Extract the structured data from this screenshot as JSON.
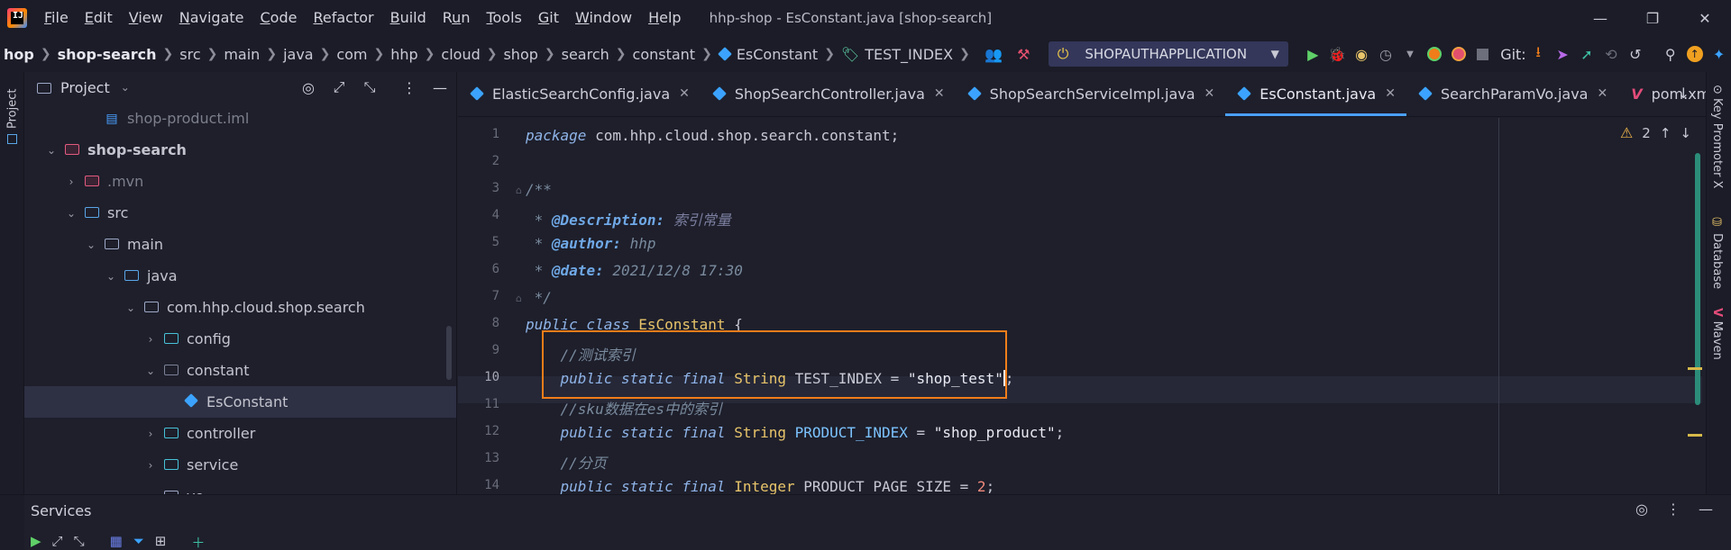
{
  "window": {
    "title": "hhp-shop - EsConstant.java [shop-search]",
    "minimize": "—",
    "maximize": "❐",
    "close": "✕"
  },
  "menu": [
    {
      "pre": "",
      "u": "F",
      "post": "ile"
    },
    {
      "pre": "",
      "u": "E",
      "post": "dit"
    },
    {
      "pre": "",
      "u": "V",
      "post": "iew"
    },
    {
      "pre": "",
      "u": "N",
      "post": "avigate"
    },
    {
      "pre": "",
      "u": "C",
      "post": "ode"
    },
    {
      "pre": "",
      "u": "R",
      "post": "efactor"
    },
    {
      "pre": "",
      "u": "B",
      "post": "uild"
    },
    {
      "pre": "R",
      "u": "u",
      "post": "n"
    },
    {
      "pre": "",
      "u": "T",
      "post": "ools"
    },
    {
      "pre": "",
      "u": "G",
      "post": "it"
    },
    {
      "pre": "",
      "u": "W",
      "post": "indow"
    },
    {
      "pre": "",
      "u": "H",
      "post": "elp"
    }
  ],
  "breadcrumb": [
    "hop",
    "shop-search",
    "src",
    "main",
    "java",
    "com",
    "hhp",
    "cloud",
    "shop",
    "search",
    "constant",
    "EsConstant",
    "TEST_INDEX"
  ],
  "run_config": "SHOPAUTHAPPLICATION",
  "git_label": "Git:",
  "project": {
    "title": "Project",
    "tree": [
      {
        "label": "shop-product.iml",
        "indent": 3,
        "chev": "",
        "icon": "iml",
        "dim": true
      },
      {
        "label": "shop-search",
        "indent": 1,
        "chev": "v",
        "icon": "folder-pink",
        "bold": true
      },
      {
        "label": ".mvn",
        "indent": 2,
        "chev": ">",
        "icon": "folder-pink-solid",
        "dim": true
      },
      {
        "label": "src",
        "indent": 2,
        "chev": "v",
        "icon": "folder-src"
      },
      {
        "label": "main",
        "indent": 3,
        "chev": "v",
        "icon": "folder"
      },
      {
        "label": "java",
        "indent": 4,
        "chev": "v",
        "icon": "folder-java"
      },
      {
        "label": "com.hhp.cloud.shop.search",
        "indent": 5,
        "chev": "v",
        "icon": "folder"
      },
      {
        "label": "config",
        "indent": 6,
        "chev": ">",
        "icon": "folder-config"
      },
      {
        "label": "constant",
        "indent": 6,
        "chev": "v",
        "icon": "folder-dim"
      },
      {
        "label": "EsConstant",
        "indent": 7,
        "chev": "",
        "icon": "class",
        "selected": true
      },
      {
        "label": "controller",
        "indent": 6,
        "chev": ">",
        "icon": "folder-config"
      },
      {
        "label": "service",
        "indent": 6,
        "chev": ">",
        "icon": "folder-service"
      },
      {
        "label": "vo",
        "indent": 6,
        "chev": ">",
        "icon": "folder"
      }
    ]
  },
  "tabs": [
    {
      "label": "ElasticSearchConfig.java",
      "icon": "class"
    },
    {
      "label": "ShopSearchController.java",
      "icon": "class"
    },
    {
      "label": "ShopSearchServiceImpl.java",
      "icon": "class"
    },
    {
      "label": "EsConstant.java",
      "icon": "class",
      "active": true
    },
    {
      "label": "SearchParamVo.java",
      "icon": "class"
    },
    {
      "label": "pom.xml (shop-search)",
      "icon": "maven"
    }
  ],
  "inspection": {
    "warnings": "2"
  },
  "code": {
    "current_line": 10,
    "lines": [
      {
        "n": "1",
        "parts": [
          [
            "kw",
            "package "
          ],
          [
            "plain",
            "com.hhp.cloud.shop.search.constant;"
          ]
        ]
      },
      {
        "n": "2",
        "parts": []
      },
      {
        "n": "3",
        "parts": [
          [
            "cm",
            "/**"
          ]
        ]
      },
      {
        "n": "4",
        "parts": [
          [
            "cm",
            " * "
          ],
          [
            "cm-tag",
            "@Description:"
          ],
          [
            "cm-cn",
            " 索引常量"
          ]
        ]
      },
      {
        "n": "5",
        "parts": [
          [
            "cm",
            " * "
          ],
          [
            "cm-tag",
            "@author:"
          ],
          [
            "cm",
            " hhp"
          ]
        ]
      },
      {
        "n": "6",
        "parts": [
          [
            "cm",
            " * "
          ],
          [
            "cm-tag",
            "@date:"
          ],
          [
            "cm",
            " 2021/12/8 17:30"
          ]
        ]
      },
      {
        "n": "7",
        "parts": [
          [
            "cm",
            " */"
          ]
        ]
      },
      {
        "n": "8",
        "parts": [
          [
            "kw",
            "public class "
          ],
          [
            "cl-name",
            "EsConstant"
          ],
          [
            "plain",
            " {"
          ]
        ]
      },
      {
        "n": "9",
        "parts": [
          [
            "cm",
            "    //测试索引"
          ]
        ]
      },
      {
        "n": "10",
        "parts": [
          [
            "kw",
            "    public static final "
          ],
          [
            "ty",
            "String "
          ],
          [
            "const",
            "TEST_INDEX"
          ],
          [
            "plain",
            " = "
          ],
          [
            "str",
            "\"shop_test\""
          ],
          [
            "caret",
            ""
          ],
          [
            "plain",
            ";"
          ]
        ]
      },
      {
        "n": "11",
        "parts": [
          [
            "cm",
            "    //sku数据在es中的索引"
          ]
        ]
      },
      {
        "n": "12",
        "parts": [
          [
            "kw",
            "    public static final "
          ],
          [
            "ty",
            "String "
          ],
          [
            "const-blue",
            "PRODUCT_INDEX"
          ],
          [
            "plain",
            " = "
          ],
          [
            "str",
            "\"shop_product\""
          ],
          [
            "plain",
            ";"
          ]
        ]
      },
      {
        "n": "13",
        "parts": [
          [
            "cm",
            "    //分页"
          ]
        ]
      },
      {
        "n": "14",
        "parts": [
          [
            "kw",
            "    public static final "
          ],
          [
            "ty",
            "Integer "
          ],
          [
            "const",
            "PRODUCT_PAGE_SIZE"
          ],
          [
            "plain",
            " = "
          ],
          [
            "num",
            "2"
          ],
          [
            "plain",
            ";"
          ]
        ]
      }
    ]
  },
  "right_strip": [
    "Key Promoter X",
    "Database",
    "Maven"
  ],
  "services": {
    "title": "Services"
  },
  "left_strip": {
    "label": "Project"
  },
  "colors": {
    "accent": "#4aa0ff",
    "highlight_box": "#f07d1a",
    "background": "#1e1f2b"
  }
}
